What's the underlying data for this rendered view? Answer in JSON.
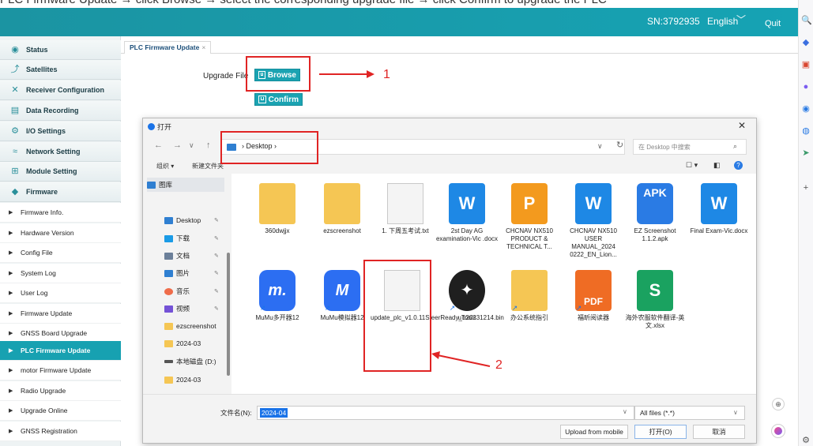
{
  "caption_text": "PLC Firmware Update → click Browse → select the corresponding upgrade file → click Confirm to upgrade the PLC",
  "header": {
    "serial": "SN:3792935",
    "language": "English",
    "quit": "Quit"
  },
  "sidebar": {
    "sections": [
      {
        "label": "Status",
        "icon": "status-icon"
      },
      {
        "label": "Satellites",
        "icon": "satellite-icon"
      },
      {
        "label": "Receiver Configuration",
        "icon": "tools-icon"
      },
      {
        "label": "Data Recording",
        "icon": "record-icon"
      },
      {
        "label": "I/O Settings",
        "icon": "gear-icon"
      },
      {
        "label": "Network Setting",
        "icon": "wifi-icon"
      },
      {
        "label": "Module Setting",
        "icon": "module-icon"
      },
      {
        "label": "Firmware",
        "icon": "firmware-icon"
      }
    ],
    "sub_items": [
      {
        "label": "Firmware Info."
      },
      {
        "label": "Hardware Version"
      },
      {
        "label": "Config File"
      },
      {
        "label": "System Log"
      },
      {
        "label": "User Log"
      },
      {
        "label": "Firmware Update"
      },
      {
        "label": "GNSS Board Upgrade"
      },
      {
        "label": "PLC Firmware Update",
        "active": true
      },
      {
        "label": "motor Firmware Update"
      },
      {
        "label": "Radio Upgrade"
      },
      {
        "label": "Upgrade Online"
      },
      {
        "label": "GNSS Registration"
      }
    ]
  },
  "tab": {
    "label": "PLC Firmware Update",
    "close": "×"
  },
  "upgrade": {
    "label": "Upgrade File",
    "browse": "Browse",
    "confirm": "Confirm"
  },
  "annotations": {
    "one": "1",
    "two": "2"
  },
  "dialog": {
    "title": "打开",
    "close": "✕",
    "path": "› Desktop ›",
    "search_placeholder": "在 Desktop 中搜索",
    "organize": "组织 ▾",
    "new_folder": "新建文件夹",
    "nav": [
      {
        "label": "图库",
        "color": "#2f7fd1",
        "selected": true
      },
      {
        "label": "Desktop",
        "color": "#2f7fd1",
        "pin": "📌"
      },
      {
        "label": "下载",
        "color": "#1a9be6",
        "pin": "📌"
      },
      {
        "label": "文档",
        "color": "#6b7f99",
        "pin": "📌"
      },
      {
        "label": "图片",
        "color": "#2f7fd1",
        "pin": "📌"
      },
      {
        "label": "音乐",
        "color": "#ef6c4a",
        "pin": "📌"
      },
      {
        "label": "视频",
        "color": "#7452d6",
        "pin": "📌"
      },
      {
        "label": "ezscreenshot",
        "color": "#f5c654"
      },
      {
        "label": "2024-03",
        "color": "#f5c654"
      },
      {
        "label": "本地磁盘 (D:)",
        "color": "#555555"
      },
      {
        "label": "2024-03",
        "color": "#f5c654"
      }
    ],
    "files": [
      {
        "name": "360dwjjx",
        "kind": "folder"
      },
      {
        "name": "ezscreenshot",
        "kind": "folder"
      },
      {
        "name": "1. 下周五考试.txt",
        "kind": "doc"
      },
      {
        "name": "2st Day AG examination-Vic .docx",
        "kind": "word"
      },
      {
        "name": "CHCNAV NX510 PRODUCT & TECHNICAL T...",
        "kind": "ppt"
      },
      {
        "name": "CHCNAV NX510 USER MANUAL_2024 0222_EN_Lion...",
        "kind": "word"
      },
      {
        "name": "EZ Screenshot 1.1.2.apk",
        "kind": "apk"
      },
      {
        "name": "Final Exam-Vic.docx",
        "kind": "word"
      },
      {
        "name": "MuMu多开器12",
        "kind": "mumu"
      },
      {
        "name": "MuMu模拟器12",
        "kind": "mumu"
      },
      {
        "name": "update_plc_v1.0.11SteerReady_b20231214.bin",
        "kind": "doc"
      },
      {
        "name": "uTools",
        "kind": "utools"
      },
      {
        "name": "办公系统指引",
        "kind": "folder"
      },
      {
        "name": "福昕阅读器",
        "kind": "pdf"
      },
      {
        "name": "海外农服软件翻译-英文.xlsx",
        "kind": "xls"
      }
    ],
    "filename_label": "文件名(N):",
    "filename_value": "2024-04",
    "filetype": "All files (*.*)",
    "upload_mobile": "Upload from mobile",
    "open": "打开(O)",
    "cancel": "取消"
  },
  "colors": {
    "accent": "#17a1b1",
    "annotation_red": "#e02424"
  }
}
